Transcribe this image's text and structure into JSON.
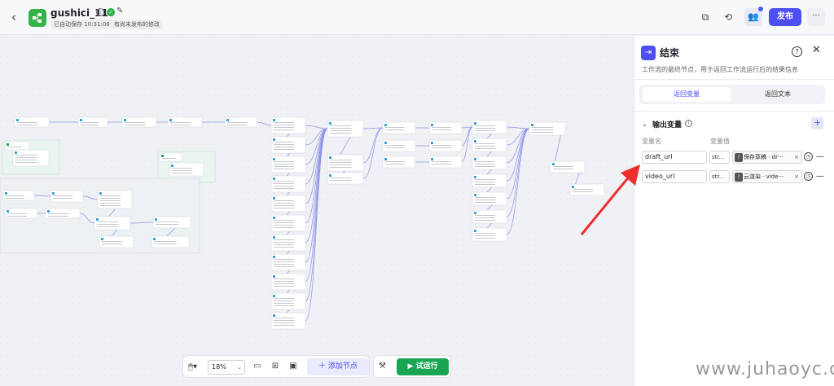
{
  "header": {
    "title": "gushici_119",
    "autosave": "已自动保存 10:31:08",
    "unpublished": "有尚未发布的修改",
    "publish_label": "发布",
    "more_label": "···"
  },
  "toolbar": {
    "zoom": "18%",
    "add_node": "添加节点",
    "run": "试运行"
  },
  "panel": {
    "title": "结束",
    "description": "工作流的最终节点，用于返回工作流运行后的结果信息",
    "tabs": [
      "返回变量",
      "返回文本"
    ],
    "active_tab": 0,
    "section_title": "输出变量",
    "col_name": "变量名",
    "col_value": "变量值",
    "variables": [
      {
        "name": "draft_url",
        "type": "str...",
        "value": "保存草稿 · dr···"
      },
      {
        "name": "video_url",
        "type": "str...",
        "value": "云渲染 · vide···"
      }
    ]
  },
  "watermark": "www.juhaoyc.com"
}
